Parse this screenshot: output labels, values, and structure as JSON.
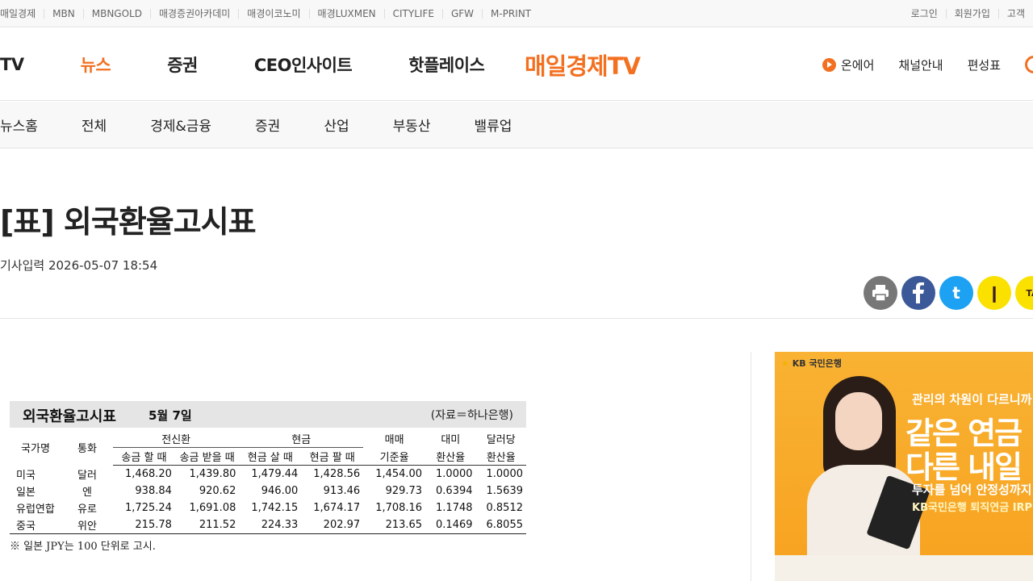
{
  "topbar": {
    "left_links": [
      "매일경제",
      "MBN",
      "MBNGOLD",
      "매경증권아카데미",
      "매경이코노미",
      "매경LUXMEN",
      "CITYLIFE",
      "GFW",
      "M-PRINT"
    ],
    "right_links": [
      "로그인",
      "회원가입",
      "고객"
    ]
  },
  "header": {
    "nav": [
      "TV",
      "뉴스",
      "증권",
      "CEO인사이트",
      "핫플레이스"
    ],
    "active_nav": "뉴스",
    "logo": "매일경제TV",
    "right_links": {
      "onair": "온에어",
      "channel": "채널안내",
      "schedule": "편성표"
    }
  },
  "subnav": [
    "뉴스홈",
    "전체",
    "경제&금융",
    "증권",
    "산업",
    "부동산",
    "밸류업"
  ],
  "article": {
    "title": "[표] 외국환율고시표",
    "date": "기사입력 2026-05-07 18:54"
  },
  "share": {
    "twitter_glyph": "t",
    "kakaostory_glyph": "❙",
    "kakaotalk_glyph": "TA"
  },
  "exchange_table": {
    "title": "외국환율고시표",
    "date": "5월 7일",
    "source": "(자료＝하나은행)",
    "headers": {
      "country": "국가명",
      "currency": "통화",
      "wire_group": "전신환",
      "cash_group": "현금",
      "wire_send": "송금 할 때",
      "wire_receive": "송금 받을 때",
      "cash_buy": "현금 살 때",
      "cash_sell": "현금 팔 때",
      "base_rate_1": "매매",
      "base_rate_2": "기준율",
      "usd_conv_1": "대미",
      "usd_conv_2": "환산율",
      "per_usd_1": "달러당",
      "per_usd_2": "환산율"
    },
    "rows": [
      [
        "미국",
        "달러",
        "1,468.20",
        "1,439.80",
        "1,479.44",
        "1,428.56",
        "1,454.00",
        "1.0000",
        "1.0000"
      ],
      [
        "일본",
        "엔",
        "938.84",
        "920.62",
        "946.00",
        "913.46",
        "929.73",
        "0.6394",
        "1.5639"
      ],
      [
        "유럽연합",
        "유로",
        "1,725.24",
        "1,691.08",
        "1,742.15",
        "1,674.17",
        "1,708.16",
        "1.1748",
        "0.8512"
      ],
      [
        "중국",
        "위안",
        "215.78",
        "211.52",
        "224.33",
        "202.97",
        "213.65",
        "0.1469",
        "6.8055"
      ]
    ],
    "note": "※ 일본 JPY는 100 단위로 고시."
  },
  "ad": {
    "bank": "KB 국민은행",
    "line1": "관리의 차원이 다르니까",
    "line2": "같은 연금",
    "line3": "다른 내일",
    "line4": "투자를 넘어 안정성까지",
    "line5": "KB국민은행 퇴직연금 IRP"
  },
  "colors": {
    "accent": "#f37021",
    "facebook": "#3b5998",
    "twitter": "#1da1f2",
    "kakao": "#fae100"
  }
}
